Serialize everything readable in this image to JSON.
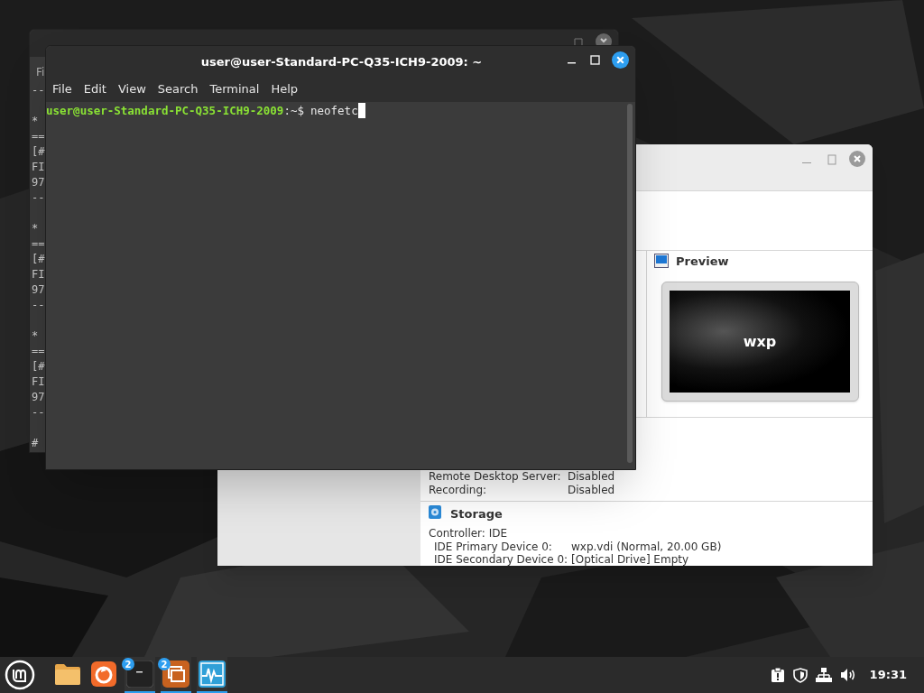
{
  "back_terminal": {
    "menu_fragment": "Fi",
    "blocks": [
      [
        "--"
      ],
      [
        "*",
        "==",
        "[#",
        "FI",
        "97",
        "--"
      ],
      [
        "*",
        "==",
        "[#",
        "FI",
        "97",
        "--"
      ],
      [
        "*",
        "==",
        "[#",
        "FI",
        "97",
        "--"
      ],
      [
        "#"
      ]
    ]
  },
  "terminal": {
    "title": "user@user-Standard-PC-Q35-ICH9-2009: ~",
    "menu": [
      "File",
      "Edit",
      "View",
      "Search",
      "Terminal",
      "Help"
    ],
    "prompt": {
      "user_host": "user@user-Standard-PC-Q35-ICH9-2009",
      "path": ":~$",
      "command": "neofetc"
    }
  },
  "virtualbox": {
    "preview": {
      "title": "Preview",
      "vm_name": "wxp"
    },
    "remote": [
      {
        "label": "Remote Desktop Server:",
        "value": "Disabled"
      },
      {
        "label": "Recording:",
        "value": "Disabled"
      }
    ],
    "storage": {
      "title": "Storage",
      "controller": "Controller: IDE",
      "devices": [
        {
          "label": "IDE Primary Device 0:",
          "value": "wxp.vdi (Normal, 20.00 GB)"
        },
        {
          "label": "IDE Secondary Device 0:",
          "value": "[Optical Drive] Empty"
        }
      ]
    }
  },
  "taskbar": {
    "apps": [
      {
        "kind": "files",
        "running": false
      },
      {
        "kind": "browser",
        "running": false
      },
      {
        "kind": "terminal",
        "running": true,
        "badge": "2"
      },
      {
        "kind": "windows",
        "running": true,
        "badge": "2"
      },
      {
        "kind": "monitor",
        "running": true
      }
    ],
    "clock": "19:31"
  }
}
